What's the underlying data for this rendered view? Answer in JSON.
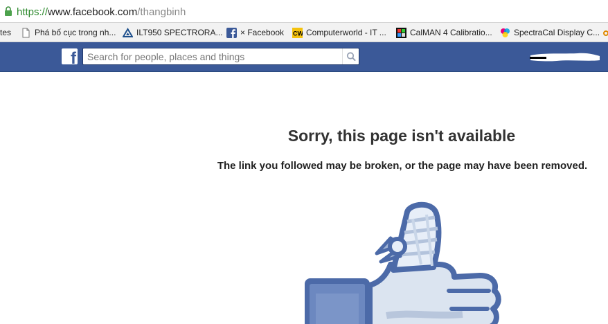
{
  "browser": {
    "url": {
      "scheme": "https://",
      "host": "www.facebook.com",
      "path": "/thangbinh"
    },
    "bookmarks": [
      {
        "label": "tes",
        "icon": "none"
      },
      {
        "label": "Phá bố cục trong nh...",
        "icon": "page-icon"
      },
      {
        "label": "ILT950 SPECTRORA...",
        "icon": "triangle-icon"
      },
      {
        "label": "× Facebook",
        "icon": "facebook-icon"
      },
      {
        "label": "Computerworld - IT ...",
        "icon": "cw-icon"
      },
      {
        "label": "CalMAN 4 Calibratio...",
        "icon": "calman-icon"
      },
      {
        "label": "SpectraCal Display C...",
        "icon": "spectracal-icon"
      }
    ]
  },
  "header": {
    "logo": "f",
    "search_placeholder": "Search for people, places and things"
  },
  "main": {
    "title": "Sorry, this page isn't available",
    "message": "The link you followed may be broken, or the page may have been removed."
  },
  "colors": {
    "facebook_blue": "#3b5998",
    "url_green": "#2e8a2e"
  }
}
